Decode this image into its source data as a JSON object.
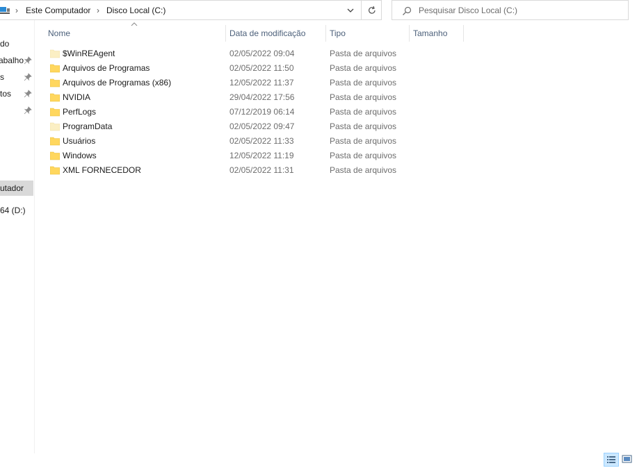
{
  "address": {
    "breadcrumbs": [
      "Este Computador",
      "Disco Local (C:)"
    ],
    "separator": "›"
  },
  "search": {
    "placeholder": "Pesquisar Disco Local (C:)"
  },
  "nav": {
    "items": [
      {
        "label": "do",
        "pinned": false
      },
      {
        "label": "abalho",
        "pinned": true
      },
      {
        "label": "s",
        "pinned": true
      },
      {
        "label": "tos",
        "pinned": true
      },
      {
        "label": "",
        "pinned": true
      },
      {
        "label": "utador",
        "pinned": false,
        "selected": true
      },
      {
        "label": "64 (D:)",
        "pinned": false
      }
    ]
  },
  "columns": {
    "name": "Nome",
    "date": "Data de modificação",
    "type": "Tipo",
    "size": "Tamanho"
  },
  "files": [
    {
      "name": "$WinREAgent",
      "date": "02/05/2022 09:04",
      "type": "Pasta de arquivos",
      "hidden": true
    },
    {
      "name": "Arquivos de Programas",
      "date": "02/05/2022 11:50",
      "type": "Pasta de arquivos",
      "hidden": false
    },
    {
      "name": "Arquivos de Programas (x86)",
      "date": "12/05/2022 11:37",
      "type": "Pasta de arquivos",
      "hidden": false
    },
    {
      "name": "NVIDIA",
      "date": "29/04/2022 17:56",
      "type": "Pasta de arquivos",
      "hidden": false
    },
    {
      "name": "PerfLogs",
      "date": "07/12/2019 06:14",
      "type": "Pasta de arquivos",
      "hidden": false
    },
    {
      "name": "ProgramData",
      "date": "02/05/2022 09:47",
      "type": "Pasta de arquivos",
      "hidden": true
    },
    {
      "name": "Usuários",
      "date": "02/05/2022 11:33",
      "type": "Pasta de arquivos",
      "hidden": false
    },
    {
      "name": "Windows",
      "date": "12/05/2022 11:19",
      "type": "Pasta de arquivos",
      "hidden": false
    },
    {
      "name": "XML FORNECEDOR",
      "date": "02/05/2022 11:31",
      "type": "Pasta de arquivos",
      "hidden": false
    }
  ],
  "colors": {
    "folder": "#ffd75e",
    "folder_hidden": "#fbefc4",
    "header_text": "#4c607a",
    "selected_bg": "#d9d9d9"
  }
}
